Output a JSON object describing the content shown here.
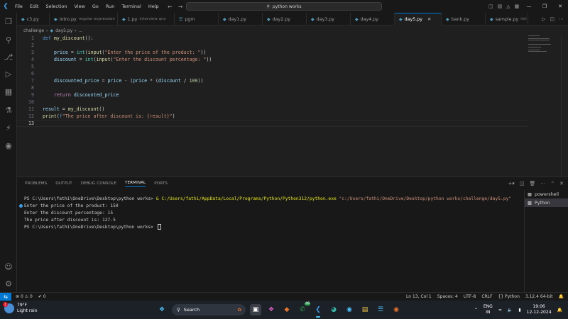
{
  "menu": [
    "File",
    "Edit",
    "Selection",
    "View",
    "Go",
    "Run",
    "Terminal",
    "Help"
  ],
  "search": {
    "text": "python works"
  },
  "tabs": [
    {
      "label": "c3.py",
      "sub": ""
    },
    {
      "label": "intro.py",
      "sub": "regular expression"
    },
    {
      "label": "1.py",
      "sub": "interview qns"
    },
    {
      "label": "pgm",
      "sub": ""
    },
    {
      "label": "day1.py",
      "sub": ""
    },
    {
      "label": "day2.py",
      "sub": ""
    },
    {
      "label": "day3.py",
      "sub": ""
    },
    {
      "label": "day4.py",
      "sub": ""
    },
    {
      "label": "day5.py",
      "sub": "",
      "active": true
    },
    {
      "label": "bank.py",
      "sub": ""
    },
    {
      "label": "sample.py",
      "sub": "inh"
    }
  ],
  "breadcrumb": {
    "folder": "challenge",
    "file": "day5.py",
    "rest": "..."
  },
  "code_lines": [
    "1",
    "2",
    "3",
    "4",
    "5",
    "6",
    "7",
    "8",
    "9",
    "10",
    "11",
    "12",
    "13"
  ],
  "code": {
    "l1": [
      "def",
      "my_discount",
      "():"
    ],
    "l3": [
      "price",
      " = ",
      "int",
      "(",
      "input",
      "(",
      "\"Enter the price of the product: \"",
      "))"
    ],
    "l4": [
      "discount",
      " = ",
      "int",
      "(",
      "input",
      "(",
      "\"Enter the discount percentage: \"",
      "))"
    ],
    "l7": [
      "discounted_price",
      " = ",
      "price",
      " - (",
      "price",
      " * (",
      "discount",
      " / ",
      "100",
      "))"
    ],
    "l9": [
      "return",
      "discounted_price"
    ],
    "l11": [
      "result",
      " = ",
      "my_discount",
      "()"
    ],
    "l12": [
      "print",
      "(",
      "f",
      "\"The price after discount is: {result}\"",
      ")"
    ]
  },
  "panel": {
    "tabs": [
      "PROBLEMS",
      "OUTPUT",
      "DEBUG CONSOLE",
      "TERMINAL",
      "PORTS"
    ],
    "active_tab": "TERMINAL",
    "terminals": [
      "powershell",
      "Python"
    ]
  },
  "terminal": {
    "line1_prompt": "PS C:\\Users\\fathi\\OneDrive\\Desktop\\python works> ",
    "line1_amp": "& ",
    "line1_exe": "C:/Users/fathi/AppData/Local/Programs/Python/Python312/python.exe",
    "line1_arg": " \"c:/Users/fathi/OneDrive/Desktop/python works/challenge/day5.py\"",
    "line2": "Enter the price of the product: 150",
    "line3": "Enter the discount percentage: 15",
    "line4": "The price after discount is: 127.5",
    "line5": "PS C:\\Users\\fathi\\OneDrive\\Desktop\\python works> "
  },
  "status": {
    "errors": "0",
    "warnings": "0",
    "ports": "0",
    "position": "Ln 13, Col 1",
    "spaces": "Spaces: 4",
    "encoding": "UTF-8",
    "eol": "CRLF",
    "language": "Python",
    "interpreter": "3.12.4 64-bit"
  },
  "taskbar": {
    "weather_badge": "1",
    "temp": "79°F",
    "condition": "Light rain",
    "search_label": "Search",
    "whatsapp_badge": "49",
    "lang_top": "ENG",
    "lang_bottom": "IN",
    "time": "19:06",
    "date": "12-12-2024"
  },
  "colors": {
    "accent": "#0078d4",
    "editor_bg": "#1f1f1f",
    "panel_bg": "#181818"
  }
}
